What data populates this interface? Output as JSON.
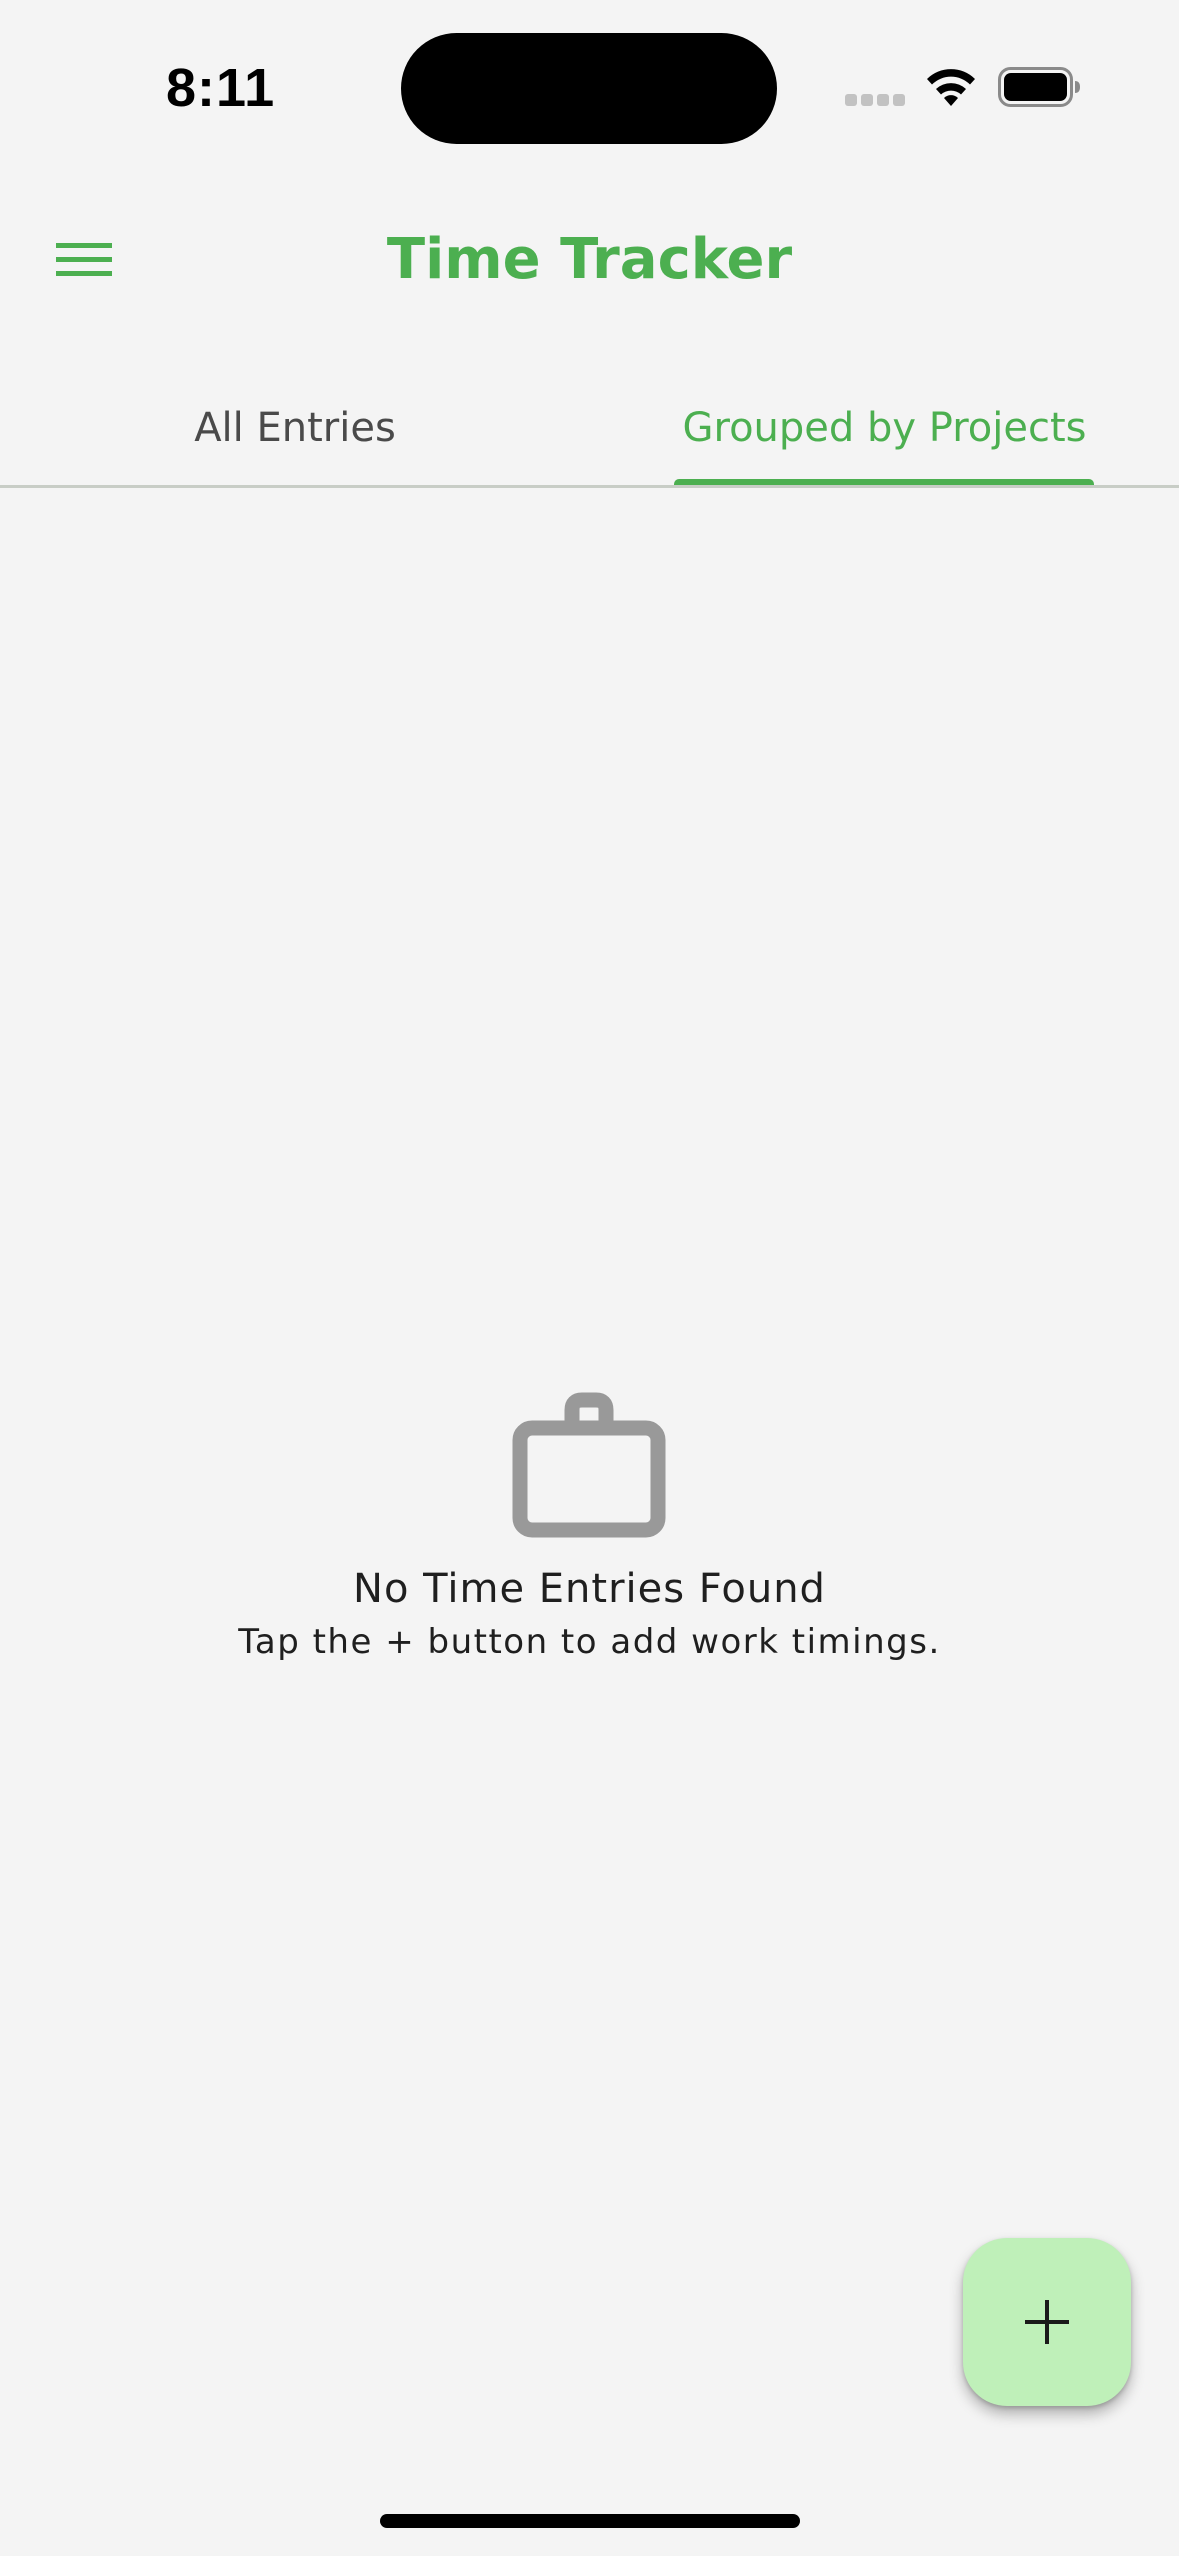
{
  "status_bar": {
    "time": "8:11",
    "signal_icon": "cellular-signal-icon",
    "wifi_icon": "wifi-icon",
    "battery_icon": "battery-full-icon"
  },
  "app_bar": {
    "title": "Time Tracker",
    "menu_icon": "hamburger-menu-icon"
  },
  "tabs": [
    {
      "label": "All Entries",
      "selected": false
    },
    {
      "label": "Grouped by Projects",
      "selected": true
    }
  ],
  "empty_state": {
    "icon": "briefcase-icon",
    "title": "No Time Entries Found",
    "subtitle": "Tap the + button to add work timings."
  },
  "fab": {
    "icon": "plus-icon"
  },
  "colors": {
    "accent": "#4caf50",
    "background": "#f4f4f4",
    "fab_background": "#bff0b9",
    "icon_gray": "#999999",
    "text_primary": "#1f1f1f",
    "tab_inactive": "#4a4a4a"
  }
}
